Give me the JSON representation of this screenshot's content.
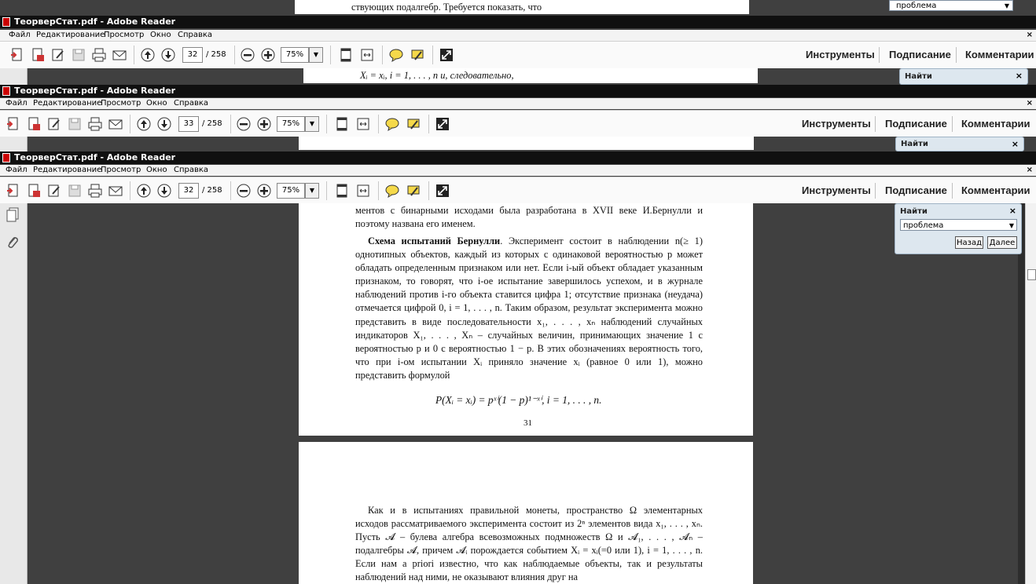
{
  "app": {
    "window_title": "ТеорверСтат.pdf - Adobe Reader",
    "menu": [
      "Файл",
      "Редактирование",
      "Просмотр",
      "Окно",
      "Справка"
    ],
    "toolbar": {
      "page_total": "/ 258",
      "zoom": "75%",
      "right_buttons": [
        "Инструменты",
        "Подписание",
        "Комментарии"
      ]
    },
    "find_panel": {
      "title": "Найти",
      "close": "×",
      "query": "проблема",
      "back_button": "Назад",
      "next_button": "Далее"
    }
  },
  "windows": [
    {
      "current_page": "32",
      "peek_text": "Xᵢ = xᵢ,  i = 1, . . . , n  и, следовательно,",
      "top_text": "ствующих подалгебр. Требуется показать, что"
    },
    {
      "current_page": "33"
    },
    {
      "current_page": "32"
    }
  ],
  "document": {
    "page_top_lines": "ментов с бинарными исходами была разработана в XVII веке И.Бернулли и поэтому названа его именем.",
    "paragraph_title": "Схема испытаний Бернулли",
    "paragraph_body": ". Эксперимент состоит в наблюдении n(≥ 1) однотипных объектов, каждый из которых с одинаковой вероятностью p может обладать определенным признаком или нет. Если i-ый объект обладает указанным признаком, то говорят, что i-ое испытание завершилось успехом, и в журнале наблюдений против i-го объекта ставится цифра 1; отсутствие признака (неудача) отмечается цифрой 0, i = 1, . . . , n. Таким образом, результат эксперимента можно представить в виде последовательности x₁, . . . , xₙ наблюдений случайных индикаторов X₁, . . . , Xₙ – случайных величин, принимающих значение 1 с вероятностью p и 0 с вероятностью 1 − p. В этих обозначениях вероятность того, что при i-ом испытании Xᵢ приняло значение xᵢ (равное 0 или 1), можно представить формулой",
    "formula": "P(Xᵢ = xᵢ) = pˣⁱ(1 − p)¹⁻ˣⁱ,  i = 1, . . . , n.",
    "page_number": "31",
    "next_page_paragraph": "Как и в испытаниях правильной монеты, пространство Ω элементарных исходов рассматриваемого эксперимента состоит из 2ⁿ элементов вида x₁, . . . , xₙ. Пусть 𝓐 – булева алгебра всевозможных подмножеств Ω и 𝓐₁, . . . , 𝓐ₙ – подалгебры 𝓐, причем 𝓐ᵢ порождается событием Xᵢ = xᵢ(=0 или 1), i = 1, . . . , n. Если нам a priori известно, что как наблюдаемые объекты, так и результаты наблюдений над ними, не оказывают влияния друг на"
  }
}
